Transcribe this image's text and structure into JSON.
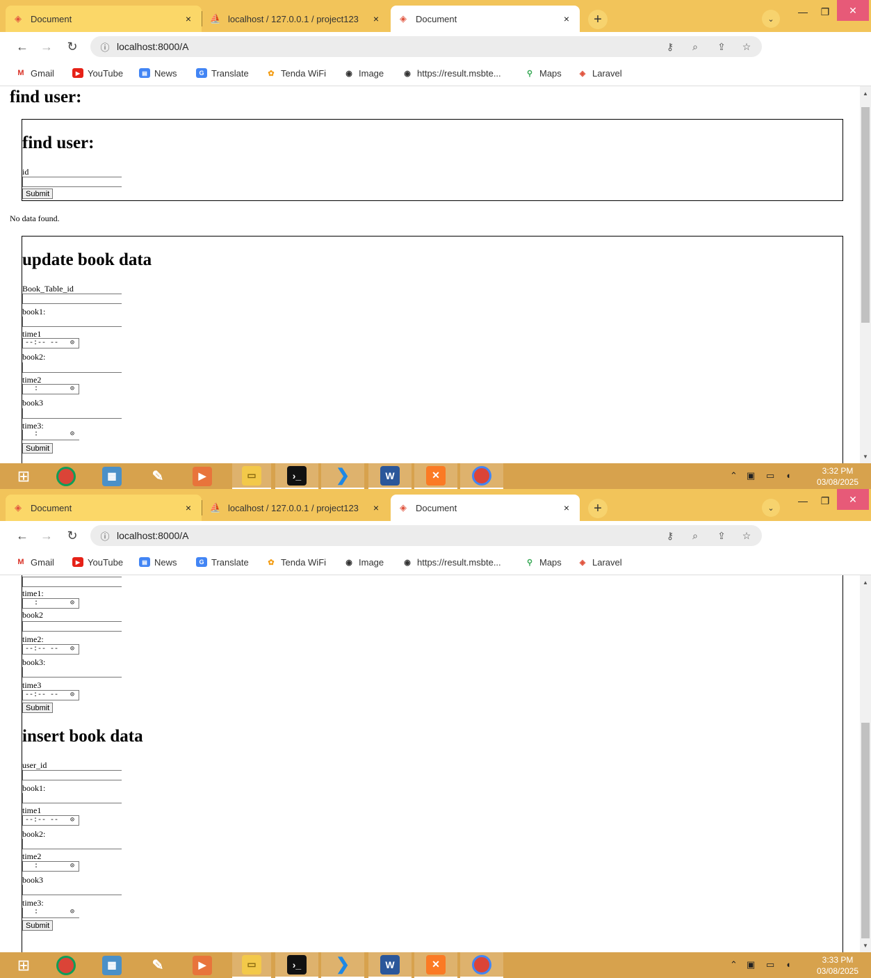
{
  "screens": [
    {
      "tabs": [
        {
          "label": "Document",
          "close": "×"
        },
        {
          "label": "localhost / 127.0.0.1 / project123",
          "close": "×"
        },
        {
          "label": "Document",
          "close": "×"
        }
      ],
      "new_tab": "+",
      "tab_search": "⌄",
      "url": "localhost:8000/A",
      "time": "3:32 PM",
      "date": "03/08/2025"
    },
    {
      "tabs": [
        {
          "label": "Document",
          "close": "×"
        },
        {
          "label": "localhost / 127.0.0.1 / project123",
          "close": "×"
        },
        {
          "label": "Document",
          "close": "×"
        }
      ],
      "new_tab": "+",
      "tab_search": "⌄",
      "url": "localhost:8000/A",
      "time": "3:33 PM",
      "date": "03/08/2025"
    }
  ],
  "bookmarks": [
    "Gmail",
    "YouTube",
    "News",
    "Translate",
    "Tenda WiFi",
    "Image",
    "https://result.msbte...",
    "Maps",
    "Laravel"
  ],
  "page": {
    "heading_top": "find user:",
    "find_user_form": {
      "heading": "find user:",
      "id_label": "id",
      "submit": "Submit"
    },
    "no_data": "No data found.",
    "update_form": {
      "heading": "update book data",
      "id_label": "Book_Table_id",
      "book1_label": "book1:",
      "time1_label": "time1",
      "book2_label": "book2:",
      "time2_label": "time2",
      "book3_label": "book3",
      "time3_label": "time3:",
      "submit": "Submit"
    },
    "update_form_lower": {
      "book1_label": "book1",
      "time1_label": "time1:",
      "book2_label": "book2",
      "time2_label": "time2:",
      "book3_label": "book3:",
      "time3_label": "time3",
      "submit": "Submit"
    },
    "insert_form": {
      "heading": "insert book data",
      "id_label": "user_id",
      "book1_label": "book1:",
      "time1_label": "time1",
      "book2_label": "book2:",
      "time2_label": "time2",
      "book3_label": "book3",
      "time3_label": "time3:",
      "submit": "Submit"
    },
    "time_value_empty": "--:-- --",
    "time_value_partial": ":",
    "clock_glyph": "⊙"
  },
  "scroll_position": {
    "screen1": 0.0,
    "screen2": 1.0
  },
  "colors": {
    "tab_strip": "#f2c45a",
    "taskbar": "#d7a24d",
    "close_button": "#e75a78"
  }
}
